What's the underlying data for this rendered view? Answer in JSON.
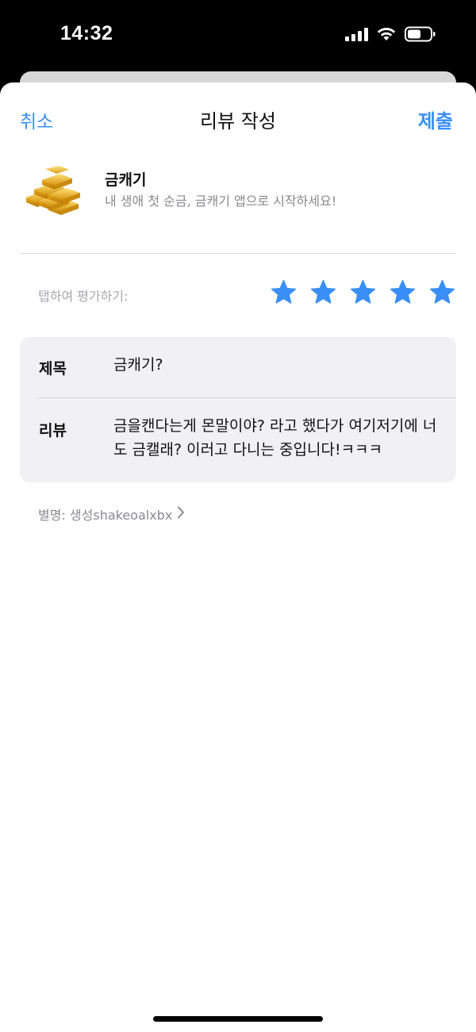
{
  "status": {
    "time": "14:32"
  },
  "nav": {
    "cancel": "취소",
    "title": "리뷰 작성",
    "submit": "제출"
  },
  "app": {
    "icon": "gold-bars-icon",
    "name": "금캐기",
    "description": "내 생애 첫 순금, 금캐기 앱으로 시작하세요!"
  },
  "rating": {
    "label": "탭하여 평가하기:",
    "stars": 5,
    "max": 5,
    "color": "#3a8ff7"
  },
  "form": {
    "title_label": "제목",
    "title_value": "금캐기?",
    "review_label": "리뷰",
    "review_value": "금을캔다는게 몬말이야? 라고 했다가 여기저기에 너도 금캘래? 이러고 다니는 중입니다!ㅋㅋㅋ"
  },
  "nickname": {
    "text": "별명: 생성shakeoalxbx",
    "icon": "chevron-right-icon"
  },
  "colors": {
    "accent": "#3a8ff7",
    "secondary_text": "#8a8a8e",
    "field_background": "#f1f1f4"
  }
}
